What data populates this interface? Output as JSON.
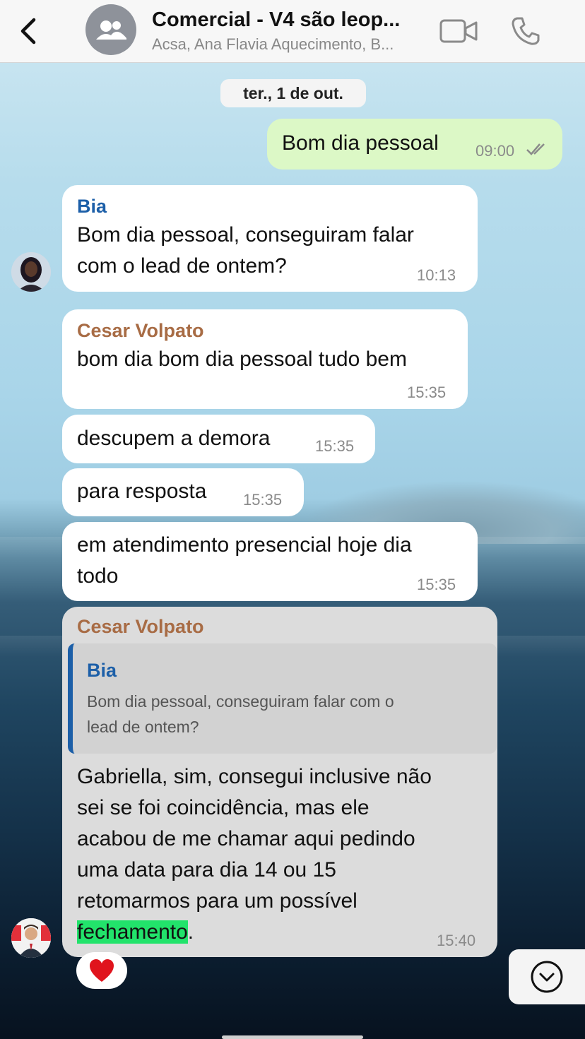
{
  "header": {
    "title": "Comercial - V4 são leop...",
    "subtitle": "Acsa, Ana Flavia Aquecimento, B..."
  },
  "date_separator": "ter., 1 de out.",
  "messages": {
    "m1": {
      "text": "Bom dia pessoal",
      "time": "09:00"
    },
    "m2": {
      "sender": "Bia",
      "line1": "Bom dia pessoal, conseguiram falar",
      "line2": "com o lead de ontem?",
      "time": "10:13"
    },
    "m3": {
      "sender": "Cesar Volpato",
      "text": "bom dia bom dia pessoal tudo bem",
      "time": "15:35"
    },
    "m4": {
      "text": "descupem a demora",
      "time": "15:35"
    },
    "m5": {
      "text": "para resposta",
      "time": "15:35"
    },
    "m6": {
      "line1": "em atendimento presencial hoje dia",
      "line2": "todo",
      "time": "15:35"
    },
    "m7": {
      "sender": "Cesar Volpato",
      "quote_sender": "Bia",
      "quote_line1": "Bom dia pessoal, conseguiram falar com o",
      "quote_line2": "lead de ontem?",
      "line1": "Gabriella, sim, consegui inclusive não",
      "line2": "sei se foi coincidência, mas ele",
      "line3": "acabou de me chamar aqui pedindo",
      "line4": "uma data para dia 14 ou 15",
      "line5": "retomarmos para um possível",
      "line6_highlight": "fechamento",
      "line6_rest": ".",
      "time": "15:40",
      "reaction": "❤️"
    }
  },
  "colors": {
    "outgoing_bubble": "#dcf8c6",
    "incoming_bubble": "#ffffff",
    "sender_bia": "#1c5fa8",
    "sender_cesar": "#a86c45",
    "highlight": "#22e36b"
  },
  "icons": [
    "back-chevron-icon",
    "group-avatar-icon",
    "video-call-icon",
    "phone-call-icon",
    "double-check-icon",
    "scroll-down-icon"
  ]
}
